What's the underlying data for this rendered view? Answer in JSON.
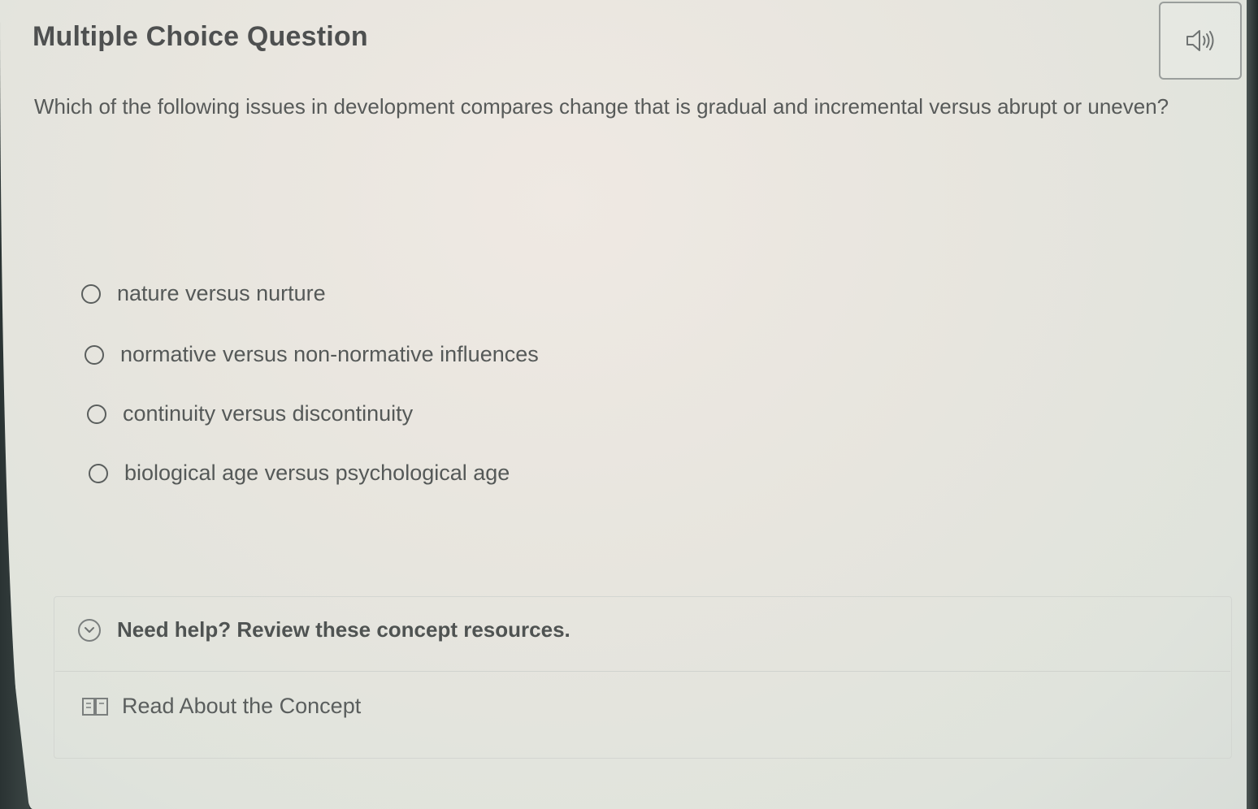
{
  "header": {
    "title": "Multiple Choice Question",
    "audio_icon": "speaker-icon"
  },
  "question": {
    "text": "Which of the following issues in development compares change that is gradual and incremental versus abrupt or uneven?"
  },
  "options": [
    {
      "label": "nature versus nurture",
      "selected": false
    },
    {
      "label": "normative versus non-normative influences",
      "selected": false
    },
    {
      "label": "continuity versus discontinuity",
      "selected": false
    },
    {
      "label": "biological age versus psychological age",
      "selected": false
    }
  ],
  "help": {
    "title": "Need help? Review these concept resources.",
    "toggle_icon": "chevron-down-icon",
    "resources": [
      {
        "label": "Read About the Concept",
        "icon": "book-icon"
      }
    ]
  },
  "colors": {
    "text_primary": "#4e5050",
    "text_secondary": "#575a59",
    "border": "#d3d6d1"
  }
}
